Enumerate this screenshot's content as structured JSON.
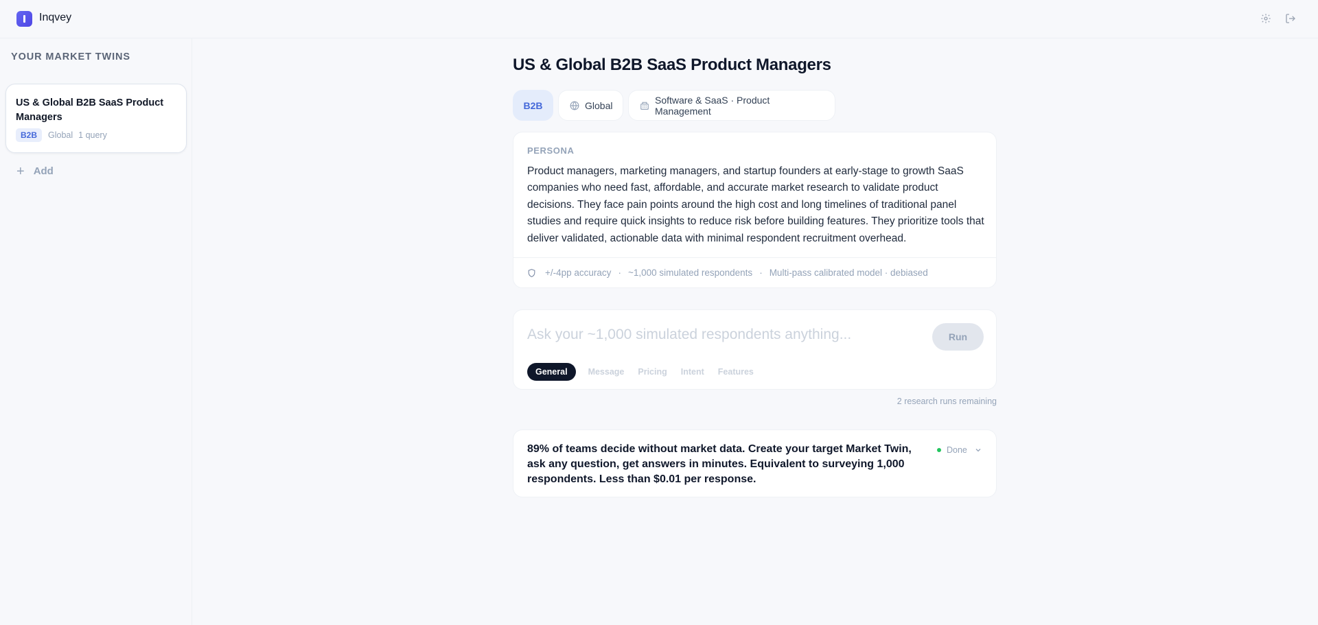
{
  "app": {
    "brand": "Inqvey"
  },
  "sidebar": {
    "heading": "YOUR MARKET TWINS",
    "twins": [
      {
        "title": "US & Global B2B SaaS Product Managers",
        "badge": "B2B",
        "region": "Global",
        "queries": "1 query"
      }
    ],
    "add_label": "Add"
  },
  "main": {
    "title": "US & Global B2B SaaS Product Managers",
    "chips": {
      "segment": "B2B",
      "region": "Global",
      "industry": "Software & SaaS · Product Management"
    },
    "persona": {
      "label": "PERSONA",
      "text": "Product managers, marketing managers, and startup founders at early-stage to growth SaaS companies who need fast, affordable, and accurate market research to validate product decisions. They face pain points around the high cost and long timelines of traditional panel studies and require quick insights to reduce risk before building features. They prioritize tools that deliver validated, actionable data with minimal respondent recruitment overhead.",
      "accuracy": "+/-4pp accuracy",
      "respondents": "~1,000 simulated respondents",
      "model": "Multi-pass calibrated model · debiased",
      "separator": "·"
    },
    "query": {
      "placeholder": "Ask your ~1,000 simulated respondents anything...",
      "value": "",
      "run_label": "Run",
      "tabs": [
        "General",
        "Message",
        "Pricing",
        "Intent",
        "Features"
      ],
      "active_tab": "General"
    },
    "remaining": "2 research runs remaining",
    "result": {
      "text": "89% of teams decide without market data. Create your target Market Twin, ask any question, get answers in minutes. Equivalent to surveying 1,000 respondents. Less than $0.01 per response.",
      "status": "Done"
    }
  },
  "colors": {
    "accent": "#4f46e5",
    "badge_bg": "#e4ecfb",
    "badge_text": "#4468d9",
    "status_done": "#22c55e",
    "background": "#f7f8fb"
  },
  "icons": {
    "settings": "gear-icon",
    "logout": "logout-icon",
    "add": "plus-icon",
    "region": "globe-icon",
    "industry": "building-icon",
    "accuracy": "shield-icon",
    "expand": "chevron-down-icon"
  }
}
